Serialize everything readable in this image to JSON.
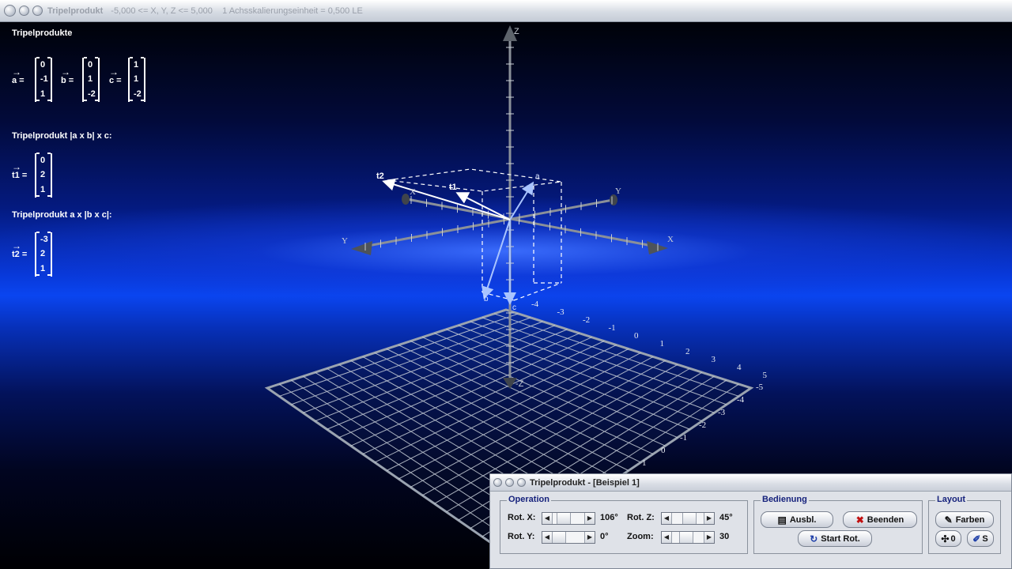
{
  "window": {
    "title": "Tripelprodukt",
    "info": "-5,000 <= X, Y, Z <= 5,000    1 Achsskalierungseinheit = 0,500 LE"
  },
  "left_panel": {
    "heading": "Tripelprodukte",
    "vectors": [
      {
        "name": "a",
        "values": [
          "0",
          "-1",
          "1"
        ]
      },
      {
        "name": "b",
        "values": [
          "0",
          "1",
          "-2"
        ]
      },
      {
        "name": "c",
        "values": [
          "1",
          "1",
          "-2"
        ]
      }
    ],
    "t1_heading": "Tripelprodukt |a x b| x c:",
    "t1": {
      "name": "t1",
      "values": [
        "0",
        "2",
        "1"
      ]
    },
    "t2_heading": "Tripelprodukt a x |b x c|:",
    "t2": {
      "name": "t2",
      "values": [
        "-3",
        "2",
        "1"
      ]
    }
  },
  "scene": {
    "axis_labels": {
      "z_top": "Z",
      "z_bottom": "-Z",
      "x": "X",
      "x_neg": "X",
      "y": "Y",
      "y_neg": "Y"
    },
    "vector_labels": {
      "a": "a",
      "b": "b",
      "c": "c",
      "t1": "t1",
      "t2": "t2"
    },
    "grid_labels_a": [
      "-4",
      "-3",
      "-2",
      "-1",
      "0",
      "1",
      "2",
      "3",
      "4",
      "5"
    ],
    "grid_labels_b": [
      "-5",
      "-4",
      "-3",
      "-2",
      "-1",
      "0",
      "1"
    ],
    "colors": {
      "vector": "#a9c4ff",
      "result": "#ffffff",
      "axis": "#8a9099",
      "grid": "#c8cfd8"
    }
  },
  "dialog": {
    "title": "Tripelprodukt - [Beispiel 1]",
    "operation": {
      "label": "Operation",
      "rot_x_label": "Rot. X:",
      "rot_x_value": "106°",
      "rot_y_label": "Rot. Y:",
      "rot_y_value": "0°",
      "rot_z_label": "Rot. Z:",
      "rot_z_value": "45°",
      "zoom_label": "Zoom:",
      "zoom_value": "30"
    },
    "bedienung": {
      "label": "Bedienung",
      "ausbl": "Ausbl.",
      "beenden": "Beenden",
      "start_rot": "Start Rot."
    },
    "layout": {
      "label": "Layout",
      "farben": "Farben",
      "null_btn": "0",
      "s_btn": "S"
    }
  }
}
